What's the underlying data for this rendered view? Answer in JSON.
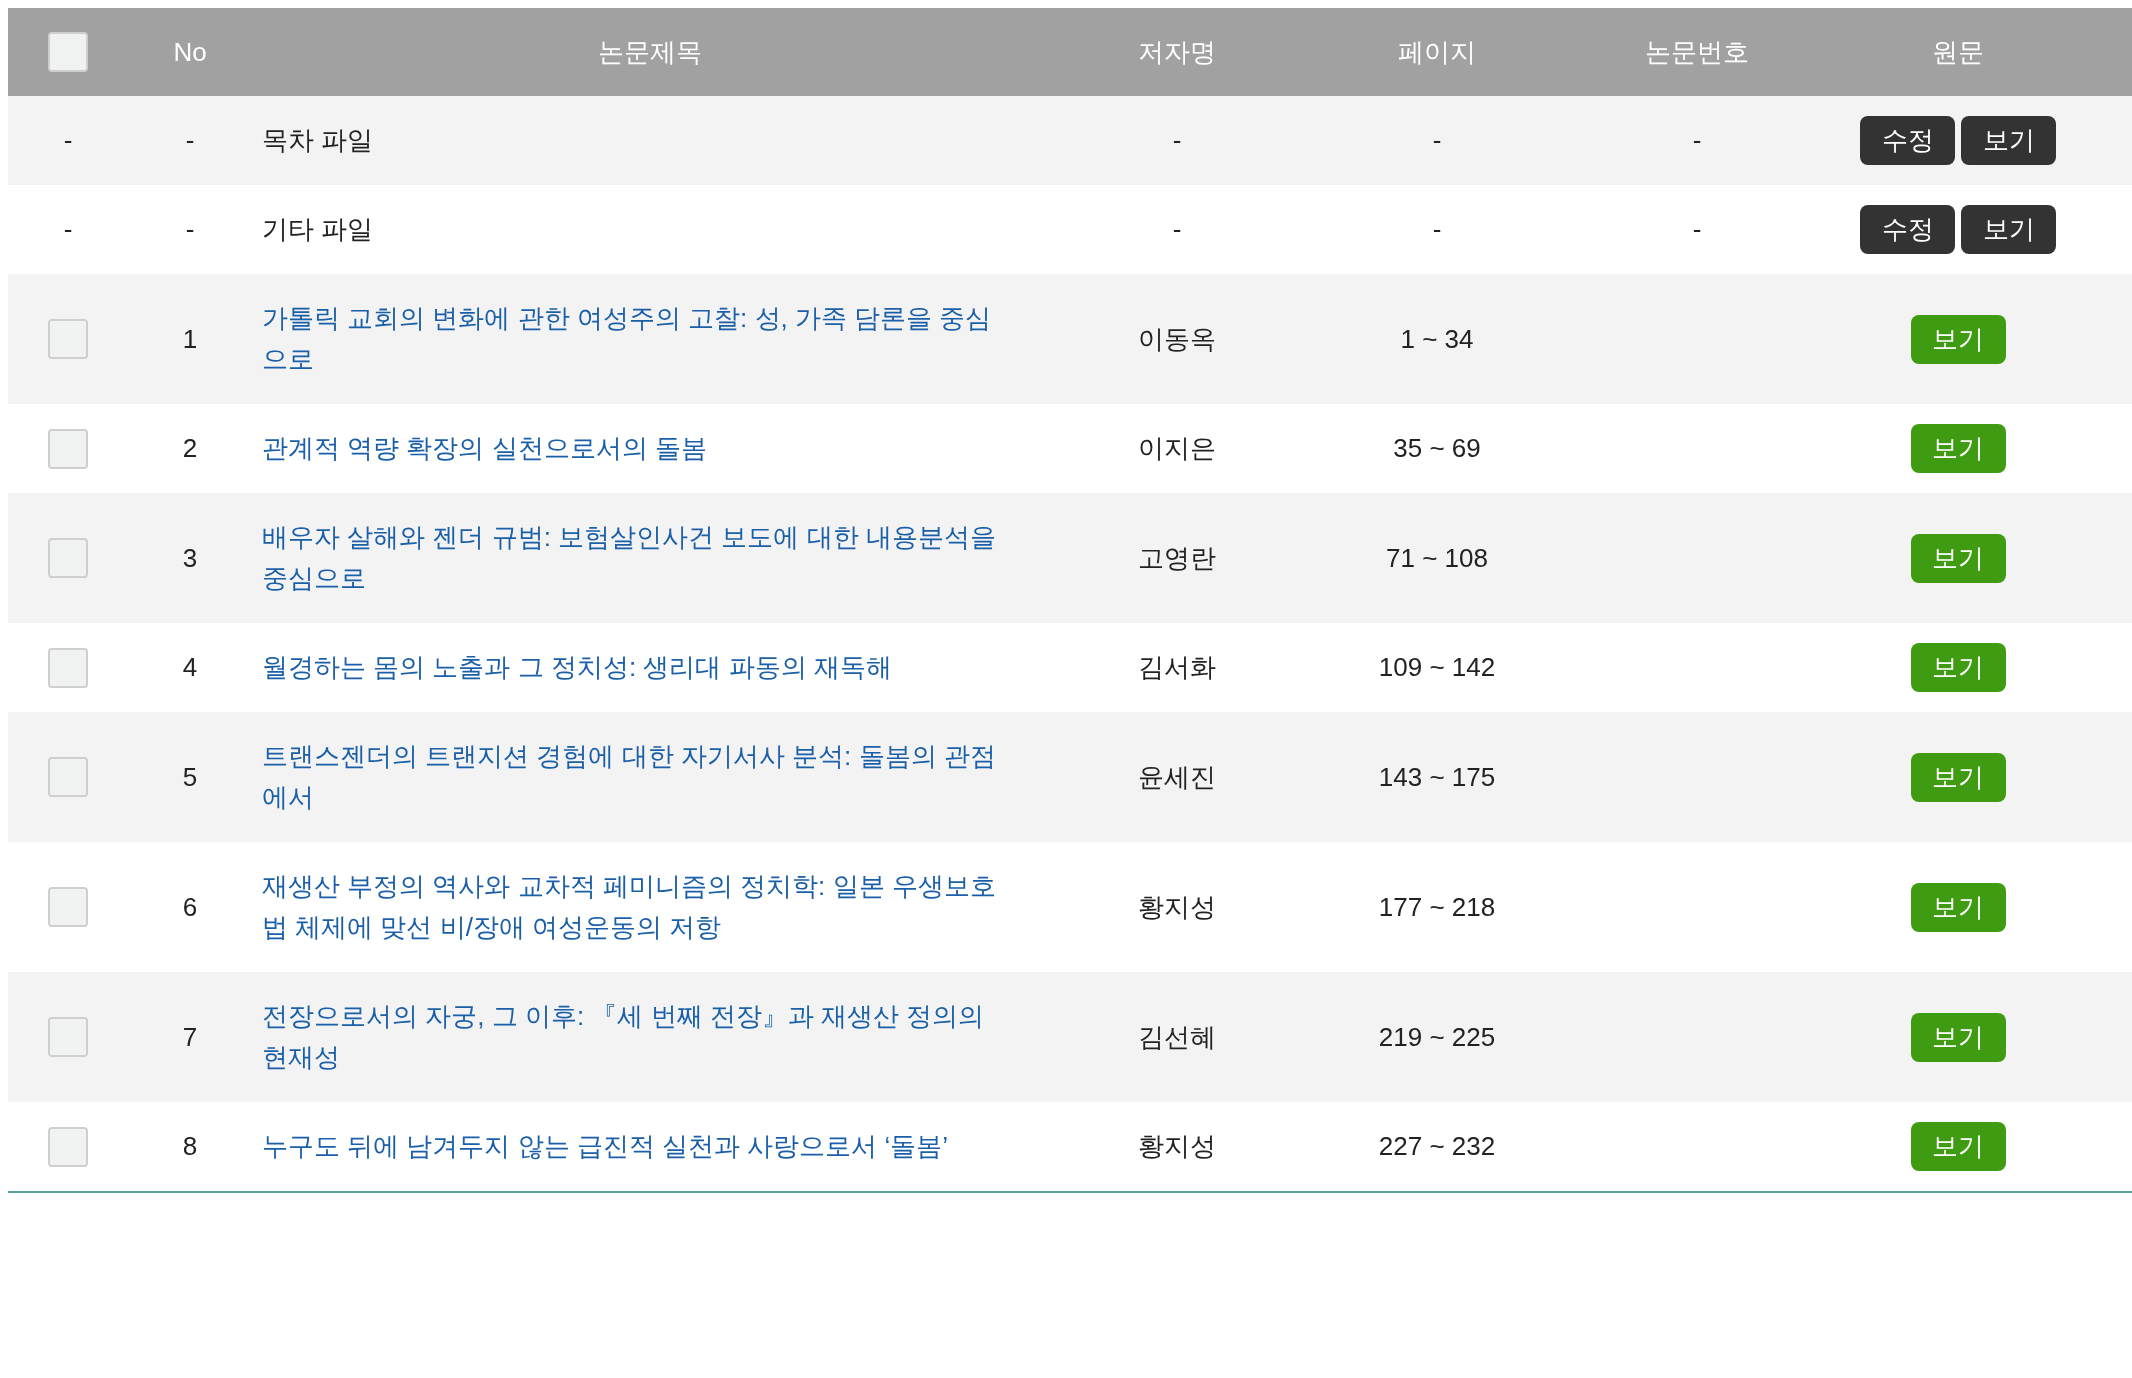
{
  "table": {
    "header_checkbox": {
      "checked": false
    },
    "columns": [
      "No",
      "논문제목",
      "저자명",
      "페이지",
      "논문번호",
      "원문"
    ],
    "rows": [
      {
        "kind": "file",
        "col_check": "-",
        "no": "-",
        "title": "목차 파일",
        "author": "-",
        "pages": "-",
        "number": "-",
        "buttons": [
          {
            "label": "수정",
            "kind": "dark"
          },
          {
            "label": "보기",
            "kind": "dark"
          }
        ]
      },
      {
        "kind": "file",
        "col_check": "-",
        "no": "-",
        "title": "기타 파일",
        "author": "-",
        "pages": "-",
        "number": "-",
        "buttons": [
          {
            "label": "수정",
            "kind": "dark"
          },
          {
            "label": "보기",
            "kind": "dark"
          }
        ]
      },
      {
        "kind": "paper",
        "checked": false,
        "no": "1",
        "title": "가톨릭 교회의 변화에 관한 여성주의 고찰: 성, 가족 담론을 중심으로",
        "author": "이동옥",
        "pages": "1 ~ 34",
        "buttons": [
          {
            "label": "보기",
            "kind": "green"
          }
        ]
      },
      {
        "kind": "paper",
        "checked": false,
        "no": "2",
        "title": "관계적 역량 확장의 실천으로서의 돌봄",
        "author": "이지은",
        "pages": "35 ~ 69",
        "buttons": [
          {
            "label": "보기",
            "kind": "green"
          }
        ]
      },
      {
        "kind": "paper",
        "checked": false,
        "no": "3",
        "title": "배우자 살해와 젠더 규범: 보험살인사건 보도에 대한 내용분석을 중심으로",
        "author": "고영란",
        "pages": "71 ~ 108",
        "buttons": [
          {
            "label": "보기",
            "kind": "green"
          }
        ]
      },
      {
        "kind": "paper",
        "checked": false,
        "no": "4",
        "title": "월경하는 몸의 노출과 그 정치성: 생리대 파동의 재독해",
        "author": "김서화",
        "pages": "109 ~ 142",
        "buttons": [
          {
            "label": "보기",
            "kind": "green"
          }
        ]
      },
      {
        "kind": "paper",
        "checked": false,
        "no": "5",
        "title": "트랜스젠더의 트랜지션 경험에 대한 자기서사 분석: 돌봄의 관점에서",
        "author": "윤세진",
        "pages": "143 ~ 175",
        "buttons": [
          {
            "label": "보기",
            "kind": "green"
          }
        ]
      },
      {
        "kind": "paper",
        "checked": false,
        "no": "6",
        "title": "재생산 부정의 역사와 교차적 페미니즘의 정치학: 일본 우생보호법 체제에 맞선 비/장애 여성운동의 저항",
        "author": "황지성",
        "pages": "177 ~ 218",
        "buttons": [
          {
            "label": "보기",
            "kind": "green"
          }
        ]
      },
      {
        "kind": "paper",
        "checked": false,
        "no": "7",
        "title": "전장으로서의 자궁, 그 이후: 『세 번째 전장』과 재생산 정의의 현재성",
        "author": "김선혜",
        "pages": "219 ~ 225",
        "buttons": [
          {
            "label": "보기",
            "kind": "green"
          }
        ]
      },
      {
        "kind": "paper",
        "checked": false,
        "no": "8",
        "title": "누구도 뒤에 남겨두지 않는 급진적 실천과 사랑으로서 ‘돌봄’",
        "author": "황지성",
        "pages": "227 ~ 232",
        "buttons": [
          {
            "label": "보기",
            "kind": "green"
          }
        ]
      }
    ]
  }
}
